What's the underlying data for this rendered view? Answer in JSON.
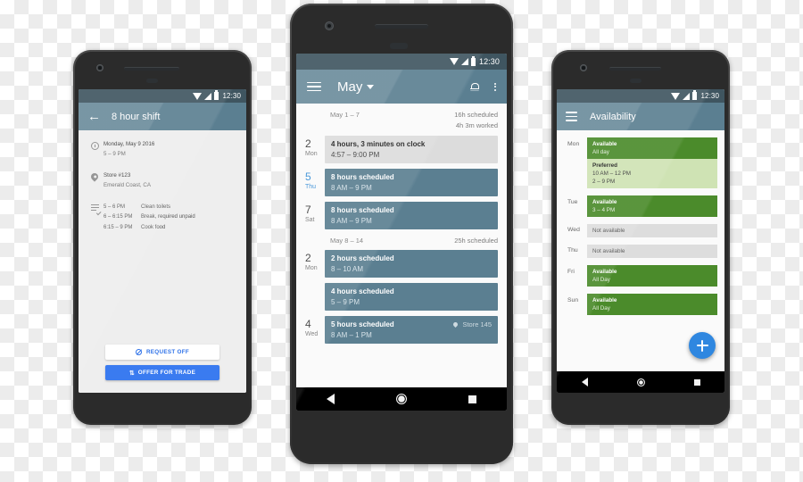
{
  "status_bar": {
    "time": "12:30",
    "icons": [
      "wifi-icon",
      "signal-icon",
      "battery-icon"
    ]
  },
  "colors": {
    "toolbar": "#5b7f91",
    "status_bar": "#3f5560",
    "card_blue": "#5b7f91",
    "card_grey": "#dcdcdc",
    "accent_blue": "#3a7bf0",
    "available_green": "#4b8b2b",
    "preferred_green": "#cfe3b4",
    "unavailable_grey": "#dddddd",
    "fab_blue": "#2f87e0",
    "today_blue": "#3a8fd6"
  },
  "phone_left": {
    "appbar": {
      "back_icon": "back-arrow-icon",
      "title": "8 hour shift"
    },
    "details": [
      {
        "icon": "clock-icon",
        "line1": "Monday, May 9 2016",
        "line2": "5 – 9 PM"
      },
      {
        "icon": "location-pin-icon",
        "line1": "Store #123",
        "line2": "Emerald Coast, CA"
      }
    ],
    "tasks_icon": "task-list-check-icon",
    "tasks": [
      {
        "time": "5 – 6 PM",
        "desc": "Clean toilets"
      },
      {
        "time": "6 – 6:15 PM",
        "desc": "Break, required unpaid"
      },
      {
        "time": "6:15 – 9 PM",
        "desc": "Cook food"
      }
    ],
    "buttons": [
      {
        "icon": "no-entry-icon",
        "label": "REQUEST OFF",
        "style": "outline"
      },
      {
        "icon": "swap-icon",
        "label": "OFFER FOR TRADE",
        "style": "filled"
      }
    ]
  },
  "phone_center": {
    "appbar": {
      "menu_icon": "hamburger-menu-icon",
      "title": "May",
      "caret_icon": "chevron-down-icon",
      "bell_icon": "notifications-bell-icon",
      "overflow_icon": "more-vertical-icon"
    },
    "weeks": [
      {
        "range": "May 1 – 7",
        "scheduled": "16h scheduled",
        "worked": "4h 3m worked",
        "days": [
          {
            "num": "2",
            "label": "Mon",
            "today": false,
            "cards": [
              {
                "style": "grey",
                "title": "4 hours, 3 minutes on clock",
                "time": "4:57 – 9:00 PM",
                "store": ""
              }
            ]
          },
          {
            "num": "5",
            "label": "Thu",
            "today": true,
            "cards": [
              {
                "style": "blue",
                "title": "8 hours scheduled",
                "time": "8 AM – 9 PM",
                "store": ""
              }
            ]
          },
          {
            "num": "7",
            "label": "Sat",
            "today": false,
            "cards": [
              {
                "style": "blue",
                "title": "8 hours scheduled",
                "time": "8 AM – 9 PM",
                "store": ""
              }
            ]
          }
        ]
      },
      {
        "range": "May 8 – 14",
        "scheduled": "25h scheduled",
        "worked": "",
        "days": [
          {
            "num": "2",
            "label": "Mon",
            "today": false,
            "cards": [
              {
                "style": "blue",
                "title": "2 hours scheduled",
                "time": "8 – 10 AM",
                "store": ""
              },
              {
                "style": "blue",
                "title": "4 hours scheduled",
                "time": "5 – 9 PM",
                "store": ""
              }
            ]
          },
          {
            "num": "4",
            "label": "Wed",
            "today": false,
            "cards": [
              {
                "style": "blue",
                "title": "5 hours scheduled",
                "time": "8 AM – 1 PM",
                "store": "Store 145"
              }
            ]
          }
        ]
      }
    ]
  },
  "phone_right": {
    "appbar": {
      "menu_icon": "hamburger-menu-icon",
      "title": "Availability"
    },
    "days": [
      {
        "day": "Mon",
        "chips": [
          {
            "style": "green",
            "title": "Available",
            "lines": [
              "All day"
            ]
          },
          {
            "style": "light",
            "title": "Preferred",
            "lines": [
              "10 AM – 12 PM",
              "2 – 9 PM"
            ]
          }
        ]
      },
      {
        "day": "Tue",
        "chips": [
          {
            "style": "green",
            "title": "Available",
            "lines": [
              "3 – 4 PM"
            ]
          }
        ]
      },
      {
        "day": "Wed",
        "chips": [
          {
            "style": "grey",
            "title": "Not available",
            "lines": []
          }
        ]
      },
      {
        "day": "Thu",
        "chips": [
          {
            "style": "grey",
            "title": "Not available",
            "lines": []
          }
        ]
      },
      {
        "day": "Fri",
        "chips": [
          {
            "style": "green",
            "title": "Available",
            "lines": [
              "All Day"
            ]
          }
        ]
      },
      {
        "day": "Sun",
        "chips": [
          {
            "style": "green",
            "title": "Available",
            "lines": [
              "All Day"
            ]
          }
        ]
      }
    ],
    "fab": {
      "icon": "plus-icon",
      "label": ""
    }
  },
  "nav_bar": {
    "back_icon": "nav-back-icon",
    "home_icon": "nav-home-icon",
    "recents_icon": "nav-recents-icon"
  }
}
